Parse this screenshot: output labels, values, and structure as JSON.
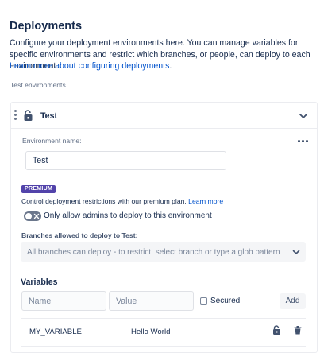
{
  "page": {
    "title": "Deployments",
    "description": "Configure your deployment environments here. You can manage variables for specific environments and restrict which branches, or people, can deploy to each environment.",
    "learn_more_link": "Learn more about configuring deployments",
    "learn_more_suffix": "."
  },
  "section": {
    "label": "Test environments"
  },
  "environment": {
    "name": "Test",
    "icons": {
      "drag": "drag-handle-icon",
      "lock": "unlock-icon",
      "collapse": "chevron-down-icon",
      "more": "more-horizontal-icon"
    },
    "name_field": {
      "label": "Environment name:",
      "value": "Test"
    },
    "premium": {
      "badge": "PREMIUM",
      "text": "Control deployment restrictions with our premium plan.",
      "link": "Learn more"
    },
    "admin_toggle": {
      "label": "Only admins to deploy to this environment",
      "label_full": "Only allow admins to deploy to this environment",
      "enabled": false
    },
    "branches": {
      "label": "Branches allowed to deploy to Test:",
      "placeholder": "All branches can deploy - to restrict: select branch or type a glob pattern"
    }
  },
  "variables": {
    "title": "Variables",
    "name_placeholder": "Name",
    "value_placeholder": "Value",
    "secured_label": "Secured",
    "secured_checked": false,
    "add_label": "Add",
    "rows": [
      {
        "name": "MY_VARIABLE",
        "value": "Hello World"
      }
    ]
  },
  "colors": {
    "link": "#0052cc",
    "premium": "#5243aa",
    "text": "#172b4d",
    "muted": "#5e6c84"
  }
}
